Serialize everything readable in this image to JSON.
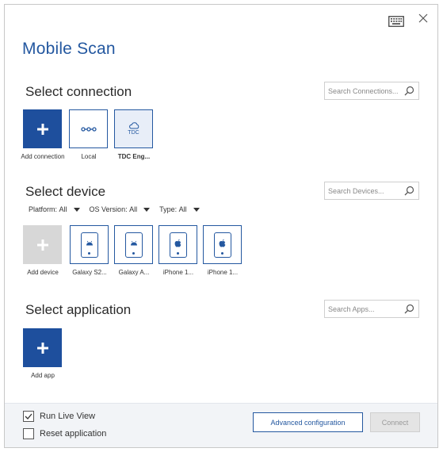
{
  "window": {
    "title": "Mobile Scan"
  },
  "icons": {
    "keyboard": "keyboard-icon",
    "close": "close-icon",
    "search": "search-icon",
    "plus": "plus-icon",
    "local": "local-connection-icon",
    "cloud": "cloud-icon",
    "android": "android-icon",
    "apple": "apple-icon",
    "check": "check-icon"
  },
  "colors": {
    "accent": "#2458a0",
    "add_tile": "#1e4f9d",
    "disabled_tile": "#d7d7d7",
    "footer_bg": "#f2f4f7"
  },
  "connection": {
    "title": "Select connection",
    "search_placeholder": "Search Connections...",
    "tiles": [
      {
        "label": "Add connection",
        "type": "add"
      },
      {
        "label": "Local",
        "type": "local"
      },
      {
        "label": "TDC Eng...",
        "type": "tdc",
        "badge": "TDC",
        "selected": true
      }
    ]
  },
  "device": {
    "title": "Select device",
    "search_placeholder": "Search Devices...",
    "filters": [
      {
        "label": "Platform:",
        "value": "All"
      },
      {
        "label": "OS Version:",
        "value": "All"
      },
      {
        "label": "Type:",
        "value": "All"
      }
    ],
    "tiles": [
      {
        "label": "Add device",
        "type": "add-disabled"
      },
      {
        "label": "Galaxy S2...",
        "type": "android"
      },
      {
        "label": "Galaxy A...",
        "type": "android"
      },
      {
        "label": "iPhone 1...",
        "type": "apple"
      },
      {
        "label": "iPhone 1...",
        "type": "apple"
      }
    ]
  },
  "application": {
    "title": "Select application",
    "search_placeholder": "Search Apps...",
    "tiles": [
      {
        "label": "Add app",
        "type": "add"
      }
    ]
  },
  "footer": {
    "run_live_view": {
      "label": "Run Live View",
      "checked": true
    },
    "reset_application": {
      "label": "Reset application",
      "checked": false
    },
    "advanced_button": "Advanced configuration",
    "connect_button": "Connect"
  }
}
